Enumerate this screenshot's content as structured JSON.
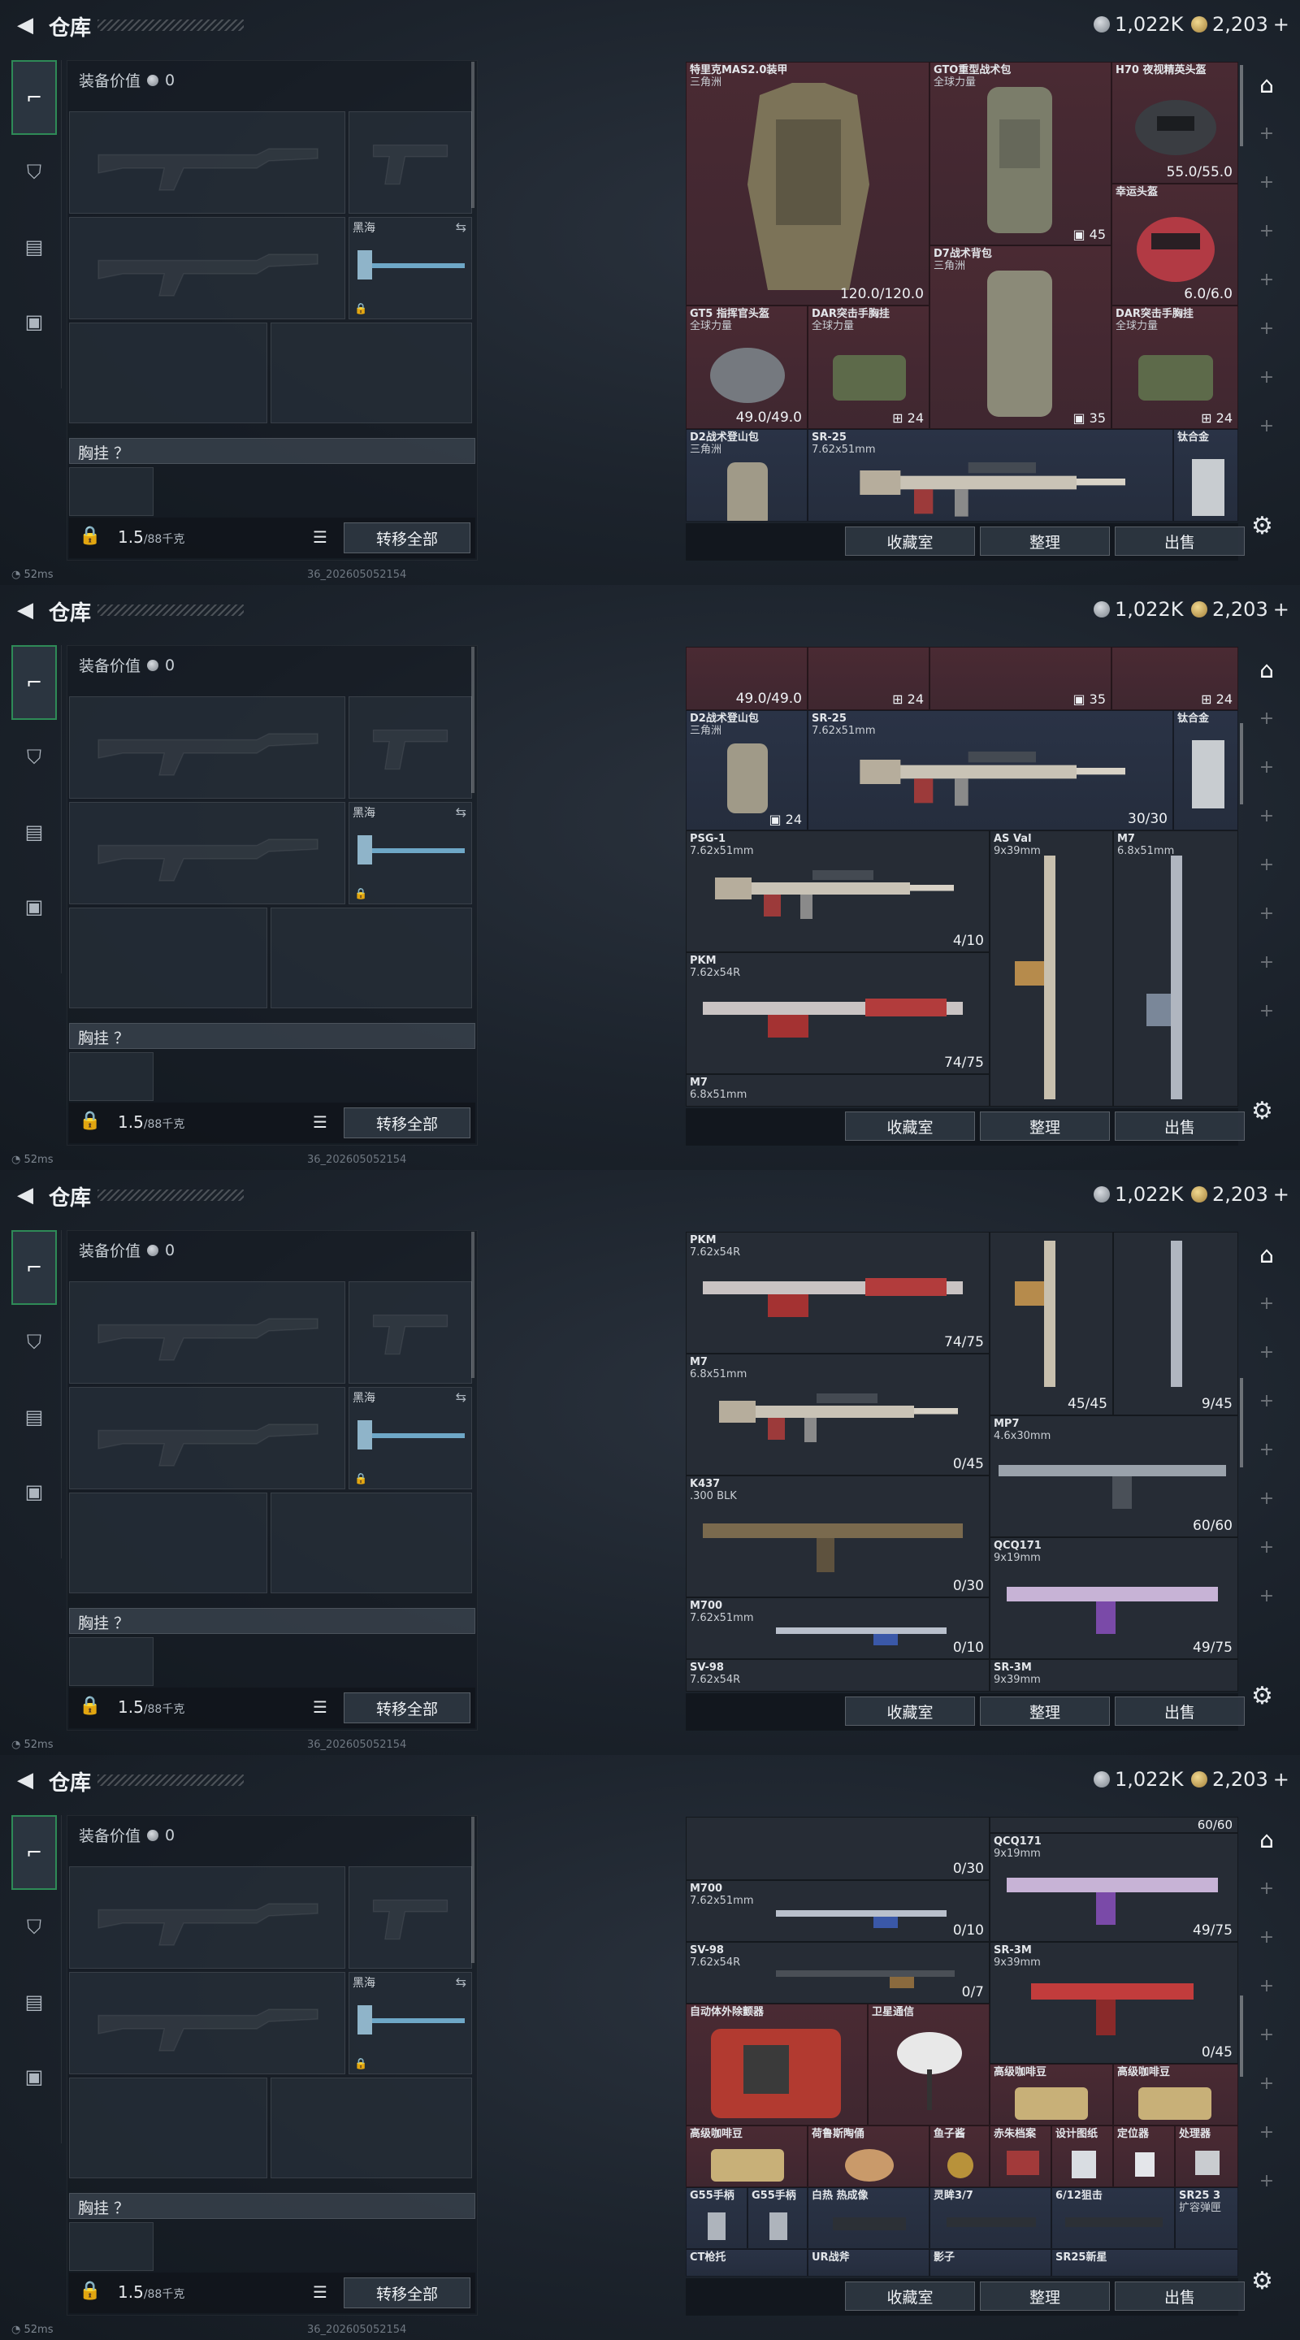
{
  "header": {
    "title": "仓库",
    "currency_silver": "1,022K",
    "currency_gold": "2,203",
    "add_label": "+"
  },
  "left": {
    "equip_value_label": "装备价值",
    "equip_value": "0",
    "melee_label": "黑海",
    "chest_label": "胸挂 ？",
    "weight": "1.5",
    "weight_max": "/88千克",
    "transfer_all": "转移全部"
  },
  "bottom_buttons": {
    "collection": "收藏室",
    "sort": "整理",
    "sell": "出售"
  },
  "status": {
    "ping": "52ms",
    "uid": "36_202605052154"
  },
  "icons": {
    "back": "back-arrow-icon",
    "settings": "gear-icon",
    "rail_top": "vault-icon"
  },
  "frame1": {
    "items": [
      {
        "name": "特里克MAS2.0装甲",
        "sub": "三角洲",
        "value": "120.0/120.0"
      },
      {
        "name": "GTO重型战术包",
        "sub": "全球力量",
        "value": "45"
      },
      {
        "name": "H70 夜视精英头盔",
        "sub": "",
        "value": "55.0/55.0"
      },
      {
        "name": "幸运头盔",
        "sub": "",
        "value": "6.0/6.0"
      },
      {
        "name": "D7战术背包",
        "sub": "三角洲",
        "value": "35"
      },
      {
        "name": "GT5 指挥官头盔",
        "sub": "全球力量",
        "value": "49.0/49.0"
      },
      {
        "name": "DAR突击手胸挂",
        "sub": "全球力量",
        "value": "24"
      },
      {
        "name": "DAR突击手胸挂",
        "sub": "全球力量",
        "value": "24"
      },
      {
        "name": "D2战术登山包",
        "sub": "三角洲",
        "value": ""
      },
      {
        "name": "SR-25",
        "sub": "7.62x51mm",
        "value": ""
      },
      {
        "name": "钛合金",
        "sub": "",
        "value": ""
      }
    ]
  },
  "frame2": {
    "items": [
      {
        "name": "",
        "sub": "",
        "value": "49.0/49.0"
      },
      {
        "name": "",
        "sub": "",
        "value": "24"
      },
      {
        "name": "",
        "sub": "",
        "value": "35"
      },
      {
        "name": "",
        "sub": "",
        "value": "24"
      },
      {
        "name": "D2战术登山包",
        "sub": "三角洲",
        "value": "24"
      },
      {
        "name": "SR-25",
        "sub": "7.62x51mm",
        "value": "30/30"
      },
      {
        "name": "钛合金",
        "sub": "",
        "value": ""
      },
      {
        "name": "PSG-1",
        "sub": "7.62x51mm",
        "value": "4/10"
      },
      {
        "name": "AS Val",
        "sub": "9x39mm",
        "value": ""
      },
      {
        "name": "M7",
        "sub": "6.8x51mm",
        "value": ""
      },
      {
        "name": "PKM",
        "sub": "7.62x54R",
        "value": "74/75"
      },
      {
        "name": "M7",
        "sub": "6.8x51mm",
        "value": ""
      }
    ]
  },
  "frame3": {
    "items": [
      {
        "name": "PKM",
        "sub": "7.62x54R",
        "value": "74/75"
      },
      {
        "name": "",
        "sub": "",
        "value": "45/45"
      },
      {
        "name": "",
        "sub": "",
        "value": "9/45"
      },
      {
        "name": "M7",
        "sub": "6.8x51mm",
        "value": "0/45"
      },
      {
        "name": "MP7",
        "sub": "4.6x30mm",
        "value": "60/60"
      },
      {
        "name": "K437",
        "sub": ".300 BLK",
        "value": "0/30"
      },
      {
        "name": "QCQ171",
        "sub": "9x19mm",
        "value": "49/75"
      },
      {
        "name": "M700",
        "sub": "7.62x51mm",
        "value": "0/10"
      },
      {
        "name": "SV-98",
        "sub": "7.62x54R",
        "value": ""
      },
      {
        "name": "SR-3M",
        "sub": "9x39mm",
        "value": ""
      }
    ]
  },
  "frame4": {
    "items": [
      {
        "name": "",
        "sub": "",
        "value": "60/60"
      },
      {
        "name": "",
        "sub": "",
        "value": "0/30"
      },
      {
        "name": "QCQ171",
        "sub": "9x19mm",
        "value": "49/75"
      },
      {
        "name": "M700",
        "sub": "7.62x51mm",
        "value": "0/10"
      },
      {
        "name": "SV-98",
        "sub": "7.62x54R",
        "value": "0/7"
      },
      {
        "name": "SR-3M",
        "sub": "9x39mm",
        "value": "0/45"
      },
      {
        "name": "自动体外除颤器",
        "sub": "",
        "value": ""
      },
      {
        "name": "卫星通信",
        "sub": "",
        "value": ""
      },
      {
        "name": "高级咖啡豆",
        "sub": "",
        "value": ""
      },
      {
        "name": "高级咖啡豆",
        "sub": "",
        "value": ""
      },
      {
        "name": "高级咖啡豆",
        "sub": "",
        "value": ""
      },
      {
        "name": "荷鲁斯陶俑",
        "sub": "",
        "value": ""
      },
      {
        "name": "鱼子酱",
        "sub": "",
        "value": ""
      },
      {
        "name": "赤朱档案",
        "sub": "",
        "value": ""
      },
      {
        "name": "设计图纸",
        "sub": "",
        "value": ""
      },
      {
        "name": "定位器",
        "sub": "",
        "value": ""
      },
      {
        "name": "处理器",
        "sub": "",
        "value": ""
      },
      {
        "name": "G55手柄",
        "sub": "",
        "value": ""
      },
      {
        "name": "G55手柄",
        "sub": "",
        "value": ""
      },
      {
        "name": "白热 热成像",
        "sub": "",
        "value": ""
      },
      {
        "name": "灵眸3/7",
        "sub": "",
        "value": ""
      },
      {
        "name": "6/12狙击",
        "sub": "",
        "value": ""
      },
      {
        "name": "SR25 3",
        "sub": "扩容弹匣",
        "value": ""
      },
      {
        "name": "CT枪托",
        "sub": "",
        "value": ""
      },
      {
        "name": "UR战斧",
        "sub": "",
        "value": ""
      },
      {
        "name": "影子",
        "sub": "",
        "value": ""
      },
      {
        "name": "SR25新星",
        "sub": "",
        "value": ""
      }
    ]
  }
}
